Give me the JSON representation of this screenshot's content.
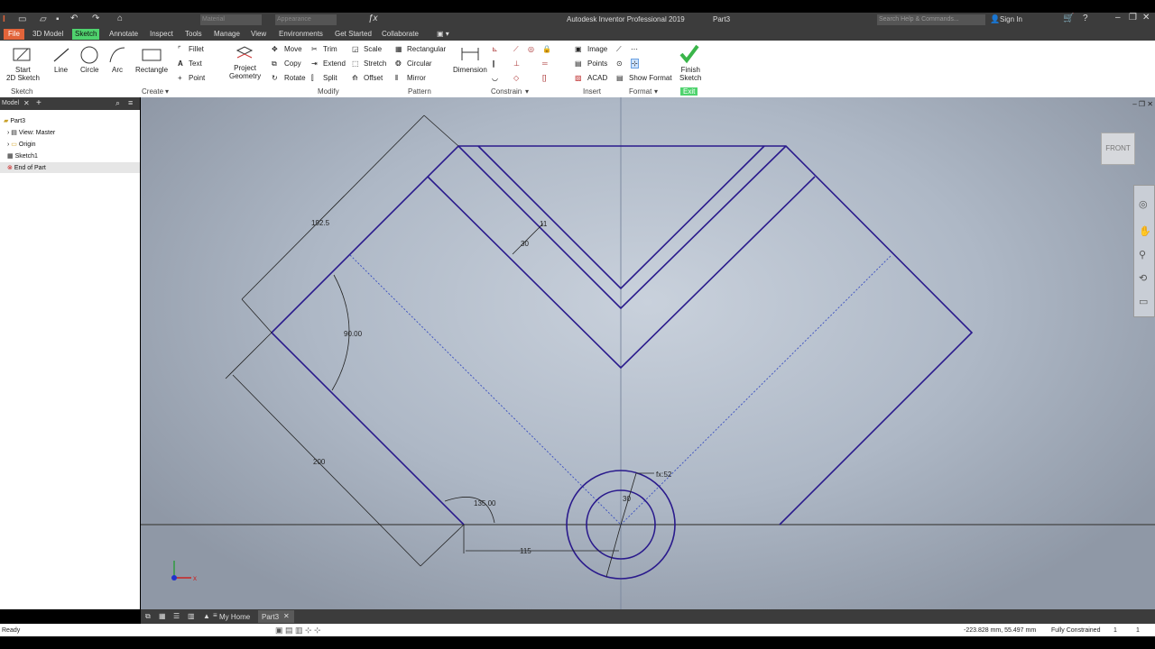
{
  "app": {
    "title": "Autodesk Inventor Professional 2019",
    "document": "Part3",
    "search_placeholder": "Search Help & Commands...",
    "sign_in": "Sign In",
    "material_value": "Material",
    "appearance_value": "Appearance"
  },
  "ribbon_tabs": [
    "File",
    "3D Model",
    "Sketch",
    "Annotate",
    "Inspect",
    "Tools",
    "Manage",
    "View",
    "Environments",
    "Get Started",
    "Collaborate"
  ],
  "ribbon": {
    "sketch_group": {
      "start_sketch": "Start\n2D Sketch",
      "label": "Sketch"
    },
    "create_group": {
      "line": "Line",
      "circle": "Circle",
      "arc": "Arc",
      "rectangle": "Rectangle",
      "fillet": "Fillet",
      "text": "Text",
      "point": "Point",
      "project_geometry": "Project\nGeometry",
      "label": "Create"
    },
    "modify_group": {
      "move": "Move",
      "trim": "Trim",
      "scale": "Scale",
      "copy": "Copy",
      "extend": "Extend",
      "stretch": "Stretch",
      "rotate": "Rotate",
      "split": "Split",
      "offset": "Offset",
      "label": "Modify"
    },
    "pattern_group": {
      "rectangular": "Rectangular",
      "circular": "Circular",
      "mirror": "Mirror",
      "label": "Pattern"
    },
    "constrain_group": {
      "dimension": "Dimension",
      "label": "Constrain"
    },
    "insert_group": {
      "image": "Image",
      "points": "Points",
      "acad": "ACAD",
      "label": "Insert"
    },
    "format_group": {
      "show_format": "Show Format",
      "label": "Format"
    },
    "exit_group": {
      "finish_sketch": "Finish\nSketch",
      "label": "Exit"
    }
  },
  "browser": {
    "tab": "Model",
    "items": [
      "Part3",
      "View: Master",
      "Origin",
      "Sketch1",
      "End of Part"
    ]
  },
  "viewcube": "FRONT",
  "dimensions": {
    "d1": "192.5",
    "d2": "90.00",
    "d3": "30",
    "d4": "11",
    "d5": "200",
    "d6": "135.00",
    "d7": "115",
    "d8": "fx:52",
    "d9": "30"
  },
  "doc_tabs": {
    "home": "My Home",
    "part": "Part3"
  },
  "status": {
    "left": "Ready",
    "coords": "-223.828 mm, 55.497 mm",
    "constraint": "Fully Constrained",
    "n1": "1",
    "n2": "1"
  },
  "colors": {
    "sketch": "#2a1a8c",
    "accent": "#4fd36e",
    "file_tab": "#e2643a"
  }
}
